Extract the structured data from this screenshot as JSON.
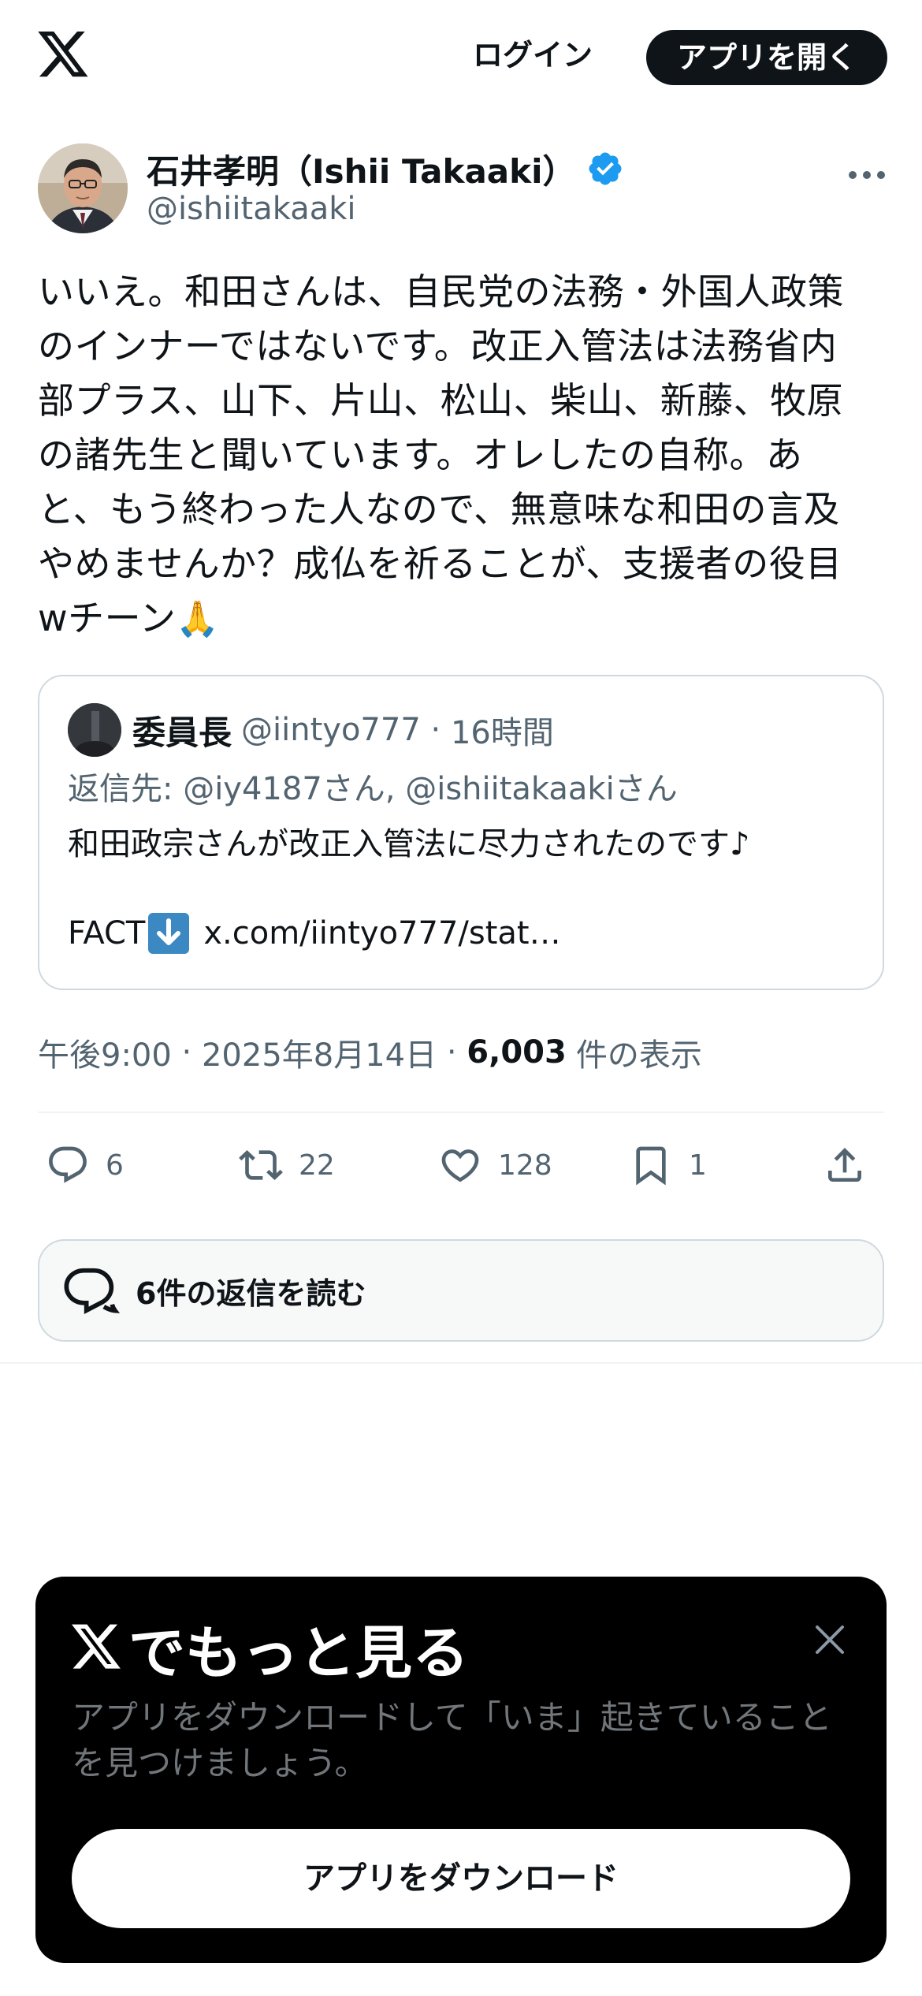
{
  "header": {
    "login_label": "ログイン",
    "open_app_label": "アプリを開く"
  },
  "tweet": {
    "author_name": "石井孝明（Ishii Takaaki）",
    "author_handle": "@ishiitakaaki",
    "verified": true,
    "text_lines": [
      "いいえ。和田さんは、自民党の法務・外国人政策",
      "のインナーではないです。改正入管法は法務省内",
      "部プラス、山下、片山、松山、柴山、新藤、牧原",
      "の諸先生と聞いています。オレしたの自称。あ",
      "と、もう終わった人なので、無意味な和田の言及",
      "やめませんか？成仏を祈ることが、支援者の役目",
      "wチーン"
    ],
    "emoji": "🙏",
    "time": "午後9:00",
    "date": "2025年8月14日",
    "views_count": "6,003",
    "views_label": "件の表示"
  },
  "quote": {
    "name": "委員長",
    "handle": "@iintyo777",
    "age": "16時間",
    "reply_to": "返信先: @iy4187さん, @ishiitakaakiさん",
    "body": "和田政宗さんが改正入管法に尽力されたのです♪",
    "link_prefix": "FACT",
    "link_text": "x.com/iintyo777/stat…"
  },
  "actions": {
    "replies": "6",
    "reposts": "22",
    "likes": "128",
    "bookmarks": "1"
  },
  "read_replies_label": "6件の返信を読む",
  "promo": {
    "title": "でもっと見る",
    "description": "アプリをダウンロードして「いま」起きていることを見つけましょう。",
    "button_label": "アプリをダウンロード"
  },
  "colors": {
    "text_primary": "#0f1419",
    "text_secondary": "#536471",
    "verified_blue": "#1d9bf0",
    "border": "#cfd9de",
    "promo_bg": "#000000"
  }
}
